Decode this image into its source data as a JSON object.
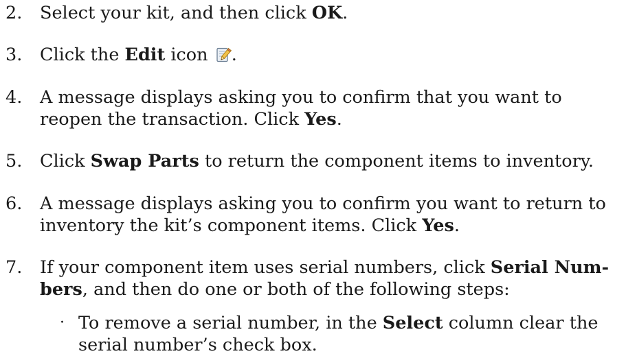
{
  "steps": [
    {
      "number": "2.",
      "lines": [
        {
          "pre": "Select your kit, and then click ",
          "bold": "OK",
          "post": "."
        }
      ]
    },
    {
      "number": "3.",
      "lines": [
        {
          "pre": "Click the ",
          "bold": "Edit",
          "post": " icon",
          "after_icon": "."
        }
      ],
      "icon": "edit-pencil-notepad-icon"
    },
    {
      "number": "4.",
      "lines": [
        {
          "pre": "A message displays asking you to confirm that you want to"
        },
        {
          "pre": "reopen the transaction. Click ",
          "bold": "Yes",
          "post": "."
        }
      ]
    },
    {
      "number": "5.",
      "lines": [
        {
          "pre": "Click ",
          "bold": "Swap Parts",
          "post": " to return the component items to inventory."
        }
      ]
    },
    {
      "number": "6.",
      "lines": [
        {
          "pre": "A message displays asking you to confirm you want to return to"
        },
        {
          "pre": "inventory the kit’s component items. Click ",
          "bold": "Yes",
          "post": "."
        }
      ]
    },
    {
      "number": "7.",
      "lines": [
        {
          "pre": "If your component item uses serial numbers, click ",
          "bold": "Serial Num-"
        },
        {
          "bold_pre": "bers",
          "post": ", and then do one or both of the following steps:"
        }
      ]
    }
  ],
  "sub_steps": [
    {
      "bullet": "·",
      "lines": [
        {
          "pre": "To remove a serial number, in the ",
          "bold": "Select",
          "post": " column clear the"
        },
        {
          "pre": "serial number’s check box."
        }
      ]
    }
  ],
  "colors": {
    "text": "#1a1a1a",
    "background": "#ffffff"
  }
}
